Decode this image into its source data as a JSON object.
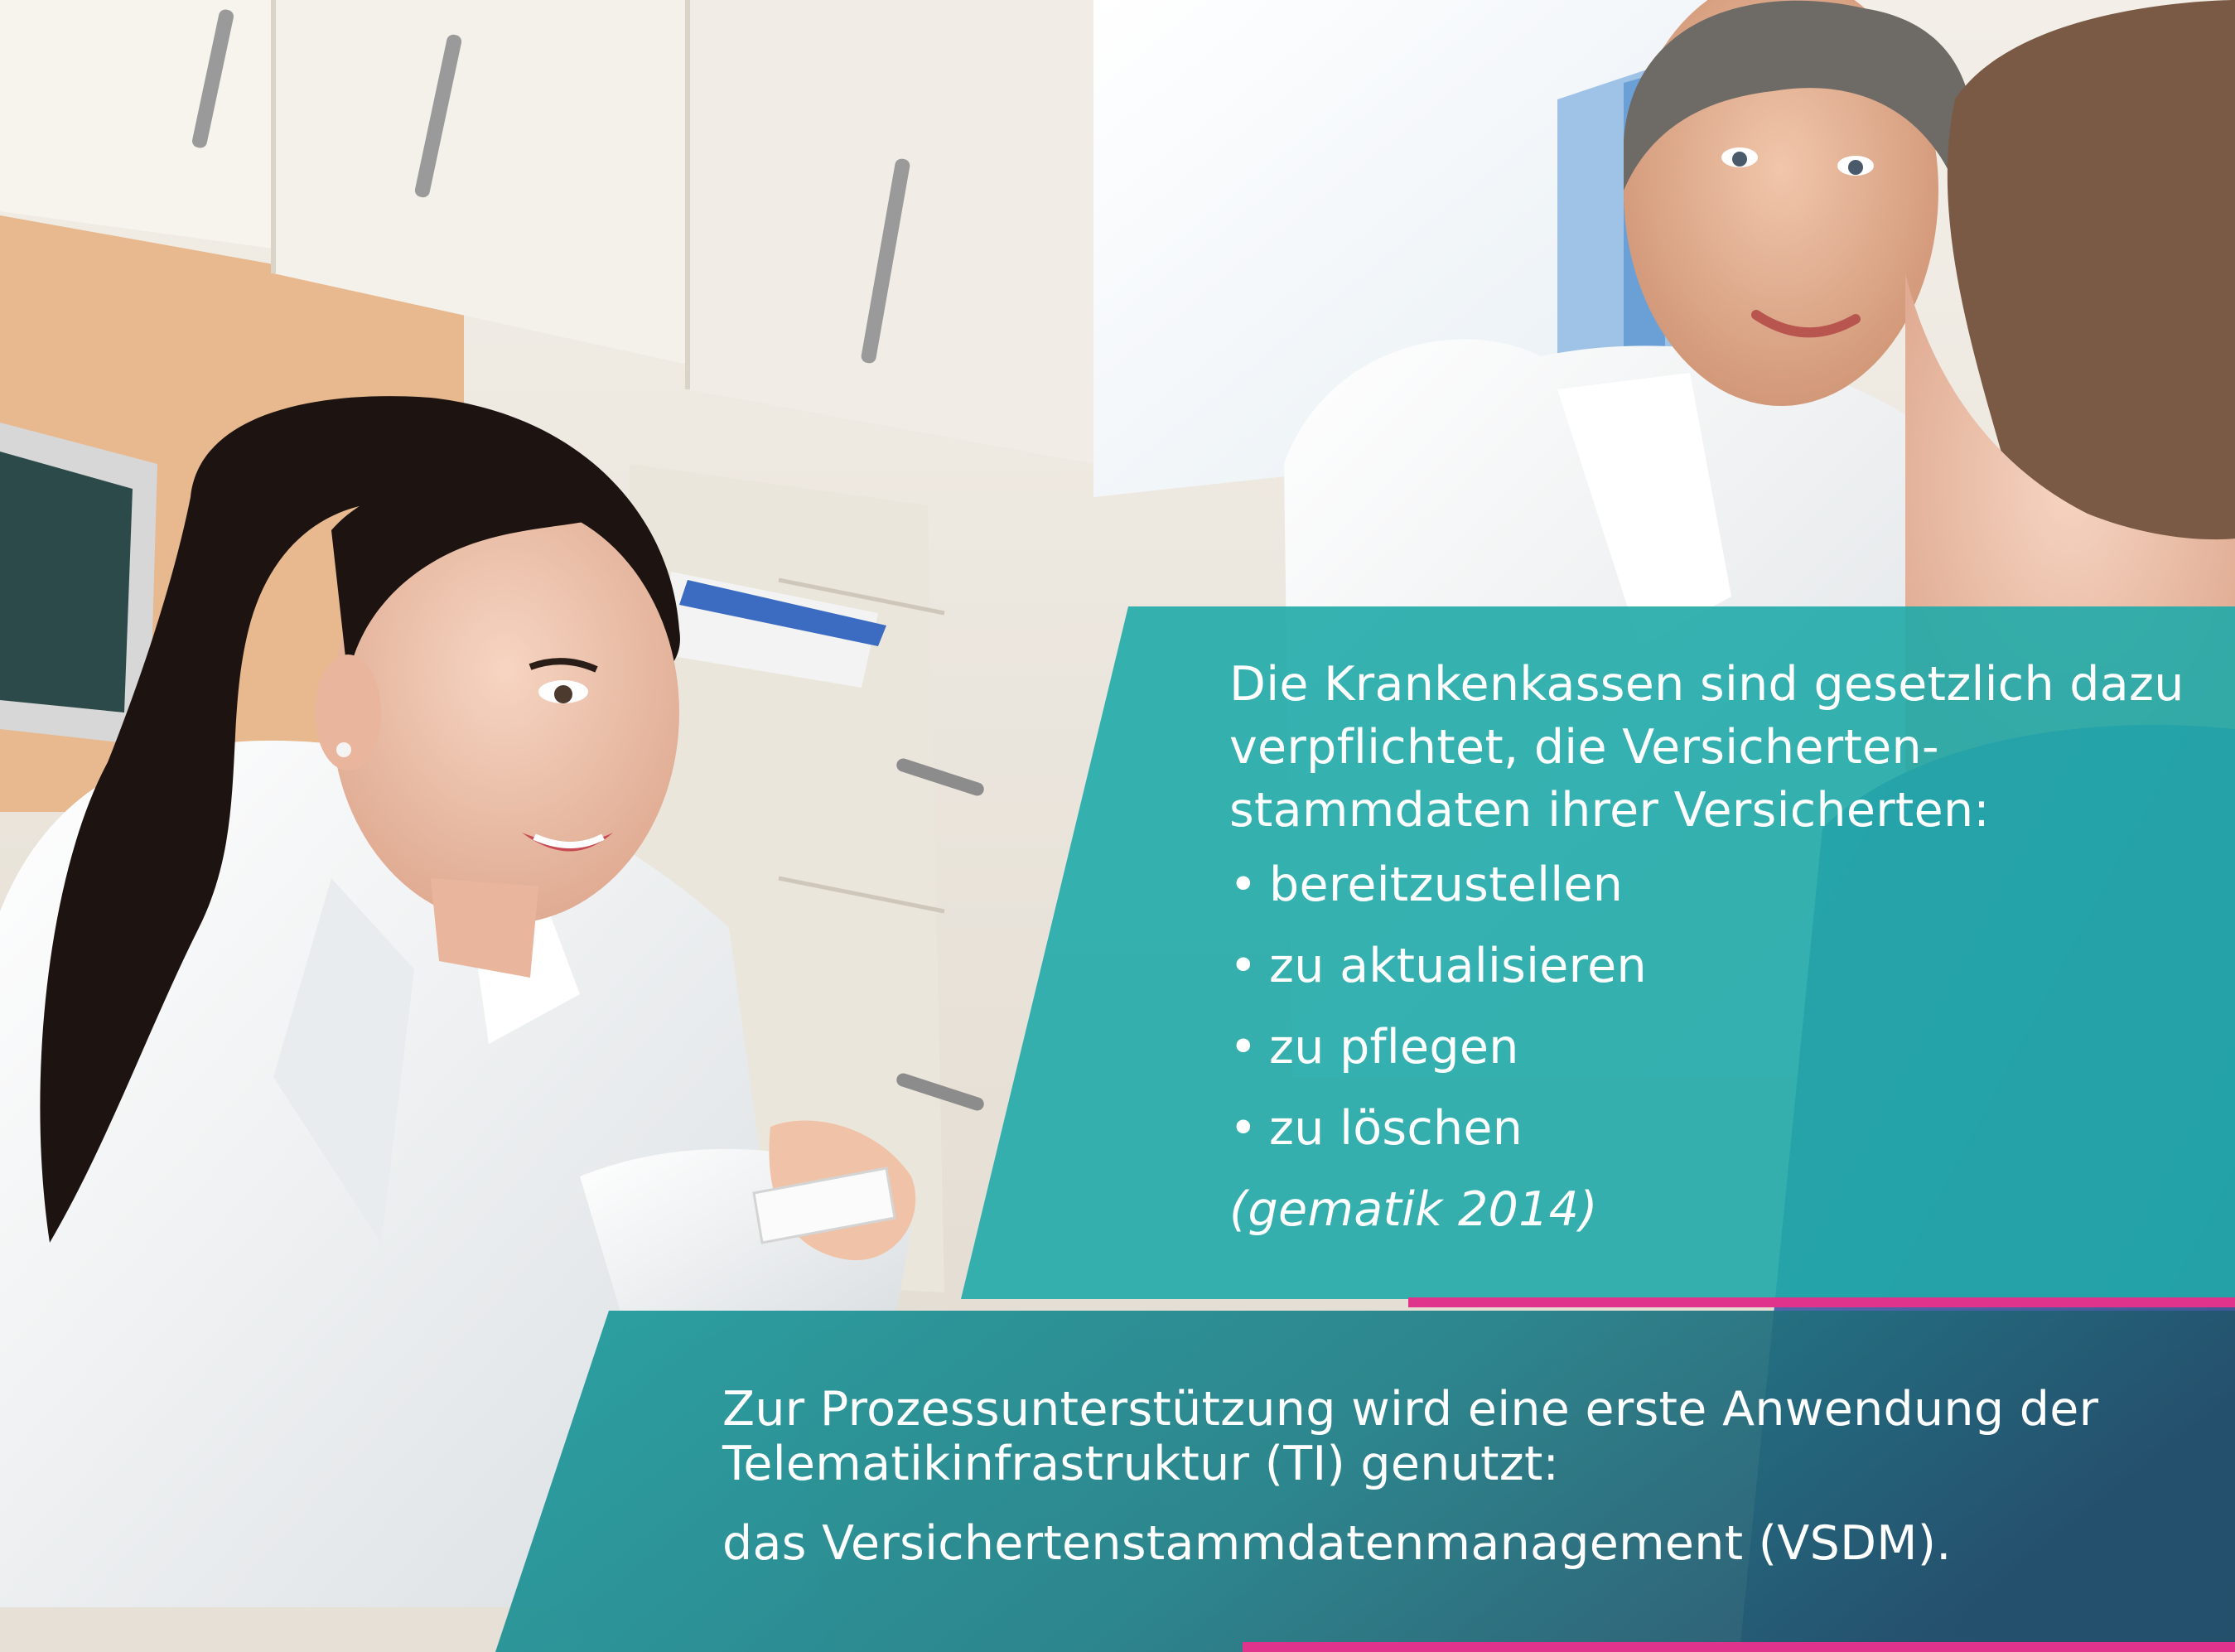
{
  "top_panel": {
    "intro": "Die Krankenkassen sind gesetzlich dazu verpflichtet, die Versicherten-stammdaten ihrer Versicherten:",
    "bullets": [
      {
        "symbol": "•",
        "text": "bereitzustellen"
      },
      {
        "symbol": "•",
        "text": "zu aktualisieren"
      },
      {
        "symbol": "•",
        "text": "zu pflegen"
      },
      {
        "symbol": "•",
        "text": "zu löschen"
      }
    ],
    "citation": "(gematik 2014)",
    "color": "#20aaa8"
  },
  "bottom_panel": {
    "line1": "Zur Prozessunterstützung wird eine erste Anwendung der Telematikinfrastruktur (TI) genutzt:",
    "line2": "das Versichertenstammdatenmanagement (VSDM).",
    "color_start": "#1e9c9c",
    "color_end": "#23506a",
    "accent": "#e0348c"
  }
}
